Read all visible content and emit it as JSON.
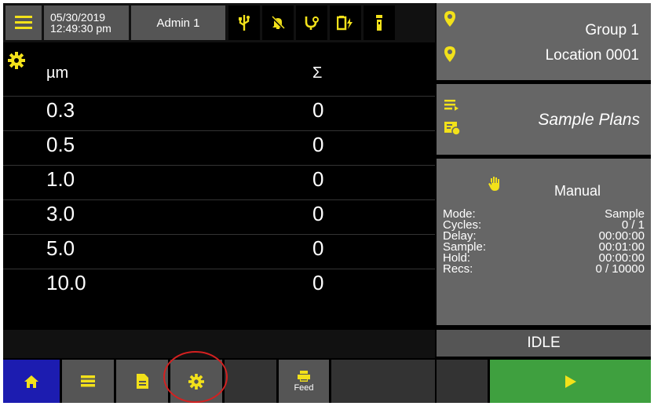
{
  "colors": {
    "accent_yellow": "#f2e11a",
    "home_blue": "#1c1cb0",
    "start_green": "#3fa03f",
    "panel_gray": "#666666",
    "annotation_red": "#d42020"
  },
  "header": {
    "date": "05/30/2019",
    "time": "12:49:30 pm",
    "user": "Admin 1",
    "status_icons": [
      "usb-icon",
      "alarm-off-icon",
      "probe-icon",
      "battery-charging-icon",
      "flashlight-icon"
    ]
  },
  "table": {
    "size_header": "µm",
    "count_header": "Σ",
    "rows": [
      {
        "size": "0.3",
        "count": "0"
      },
      {
        "size": "0.5",
        "count": "0"
      },
      {
        "size": "1.0",
        "count": "0"
      },
      {
        "size": "3.0",
        "count": "0"
      },
      {
        "size": "5.0",
        "count": "0"
      },
      {
        "size": "10.0",
        "count": "0"
      }
    ]
  },
  "location": {
    "group": "Group 1",
    "location": "Location 0001"
  },
  "sample_plans": {
    "label": "Sample Plans"
  },
  "sample_info": {
    "mode_title": "Manual",
    "labels": {
      "mode": "Mode:",
      "cycles": "Cycles:",
      "delay": "Delay:",
      "sample": "Sample:",
      "hold": "Hold:",
      "recs": "Recs:"
    },
    "values": {
      "mode": "Sample",
      "cycles": "0 / 1",
      "delay": "00:00:00",
      "sample": "00:01:00",
      "hold": "00:00:00",
      "recs": "0 / 10000"
    }
  },
  "status": {
    "state": "IDLE"
  },
  "bottom_bar": {
    "feed_label": "Feed",
    "active_tab": "home",
    "highlighted_tab": "settings"
  }
}
